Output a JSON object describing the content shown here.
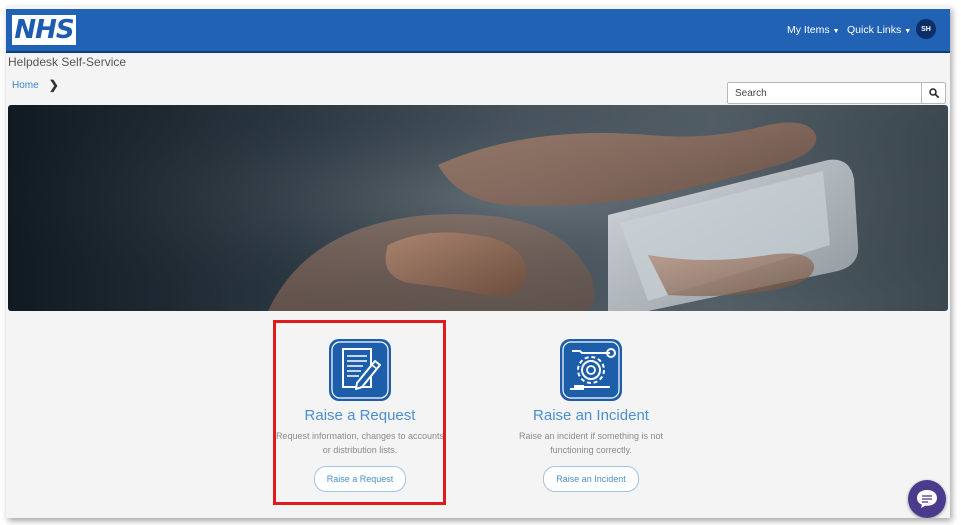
{
  "header": {
    "logo_text": "NHS",
    "menus": [
      {
        "label": "My Items"
      },
      {
        "label": "Quick Links"
      }
    ],
    "avatar_initials": "SH"
  },
  "site_title": "Helpdesk Self-Service",
  "breadcrumb": {
    "home": "Home"
  },
  "search": {
    "placeholder": "Search"
  },
  "cards": [
    {
      "title": "Raise a Request",
      "description": "Request information, changes to accounts or distribution lists.",
      "button": "Raise a Request",
      "icon": "document-pencil-icon"
    },
    {
      "title": "Raise an Incident",
      "description": "Raise an incident if something is not functioning correctly.",
      "button": "Raise an Incident",
      "icon": "gear-wrench-icon"
    }
  ],
  "colors": {
    "header_blue": "#2162b5",
    "accent_blue": "#4a8fd0",
    "highlight_red": "#e11b1b",
    "chat_purple": "#4a3b8c"
  }
}
